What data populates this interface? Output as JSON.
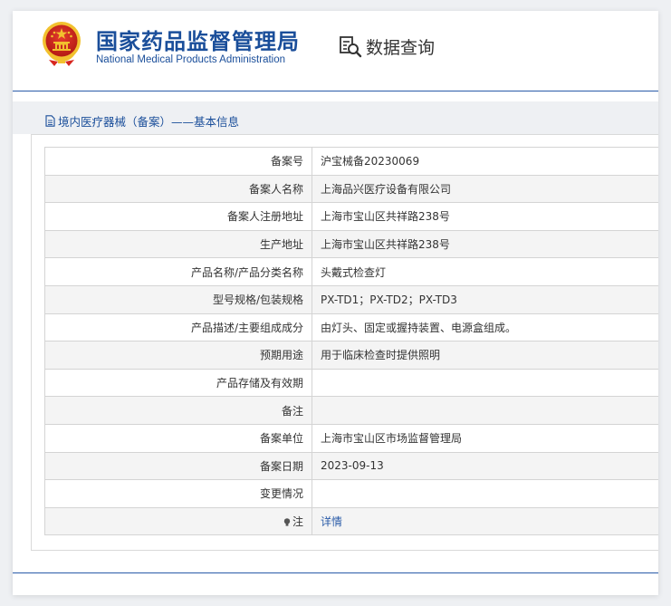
{
  "header": {
    "site_name_cn": "国家药品监督管理局",
    "site_name_en": "National Medical Products Administration",
    "query_label": "数据查询"
  },
  "section": {
    "title": "境内医疗器械（备案）——基本信息"
  },
  "record": {
    "rows": [
      {
        "label": "备案号",
        "value": "沪宝械备20230069"
      },
      {
        "label": "备案人名称",
        "value": "上海品兴医疗设备有限公司"
      },
      {
        "label": "备案人注册地址",
        "value": "上海市宝山区共祥路238号"
      },
      {
        "label": "生产地址",
        "value": "上海市宝山区共祥路238号"
      },
      {
        "label": "产品名称/产品分类名称",
        "value": "头戴式检查灯"
      },
      {
        "label": "型号规格/包装规格",
        "value": "PX-TD1；PX-TD2；PX-TD3"
      },
      {
        "label": "产品描述/主要组成成分",
        "value": "由灯头、固定或握持装置、电源盒组成。"
      },
      {
        "label": "预期用途",
        "value": "用于临床检查时提供照明"
      },
      {
        "label": "产品存储及有效期",
        "value": ""
      },
      {
        "label": "备注",
        "value": ""
      },
      {
        "label": "备案单位",
        "value": "上海市宝山区市场监督管理局"
      },
      {
        "label": "备案日期",
        "value": "2023-09-13"
      },
      {
        "label": "变更情况",
        "value": ""
      }
    ],
    "note_label": "注",
    "note_link": "详情"
  },
  "colors": {
    "brand_blue": "#1a4e9a",
    "rule_blue": "#2a5ba8",
    "emblem_red": "#d7261f",
    "emblem_gold": "#f2c12e"
  },
  "icons": {
    "emblem": "national-emblem",
    "query": "magnifier-document-icon",
    "section": "document-icon",
    "note": "lightbulb-icon"
  }
}
